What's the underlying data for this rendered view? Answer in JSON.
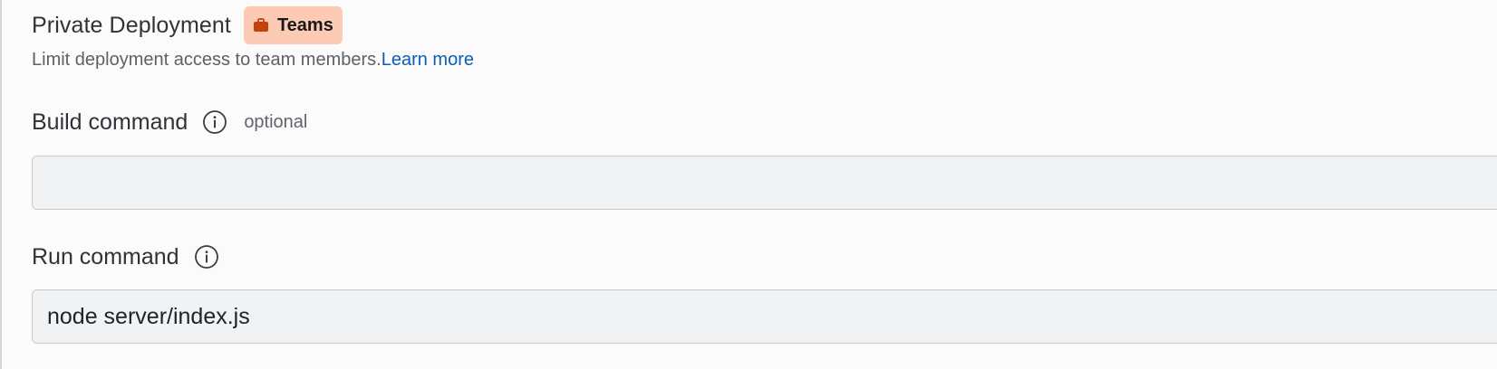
{
  "private_deployment": {
    "title": "Private Deployment",
    "badge": {
      "label": "Teams",
      "icon": "briefcase-icon",
      "color": "#fdcbb3",
      "icon_color": "#c4430a"
    },
    "description": "Limit deployment access to team members.",
    "link_text": "Learn more"
  },
  "build_command": {
    "label": "Build command",
    "icon": "info-icon",
    "hint": "optional",
    "value": "",
    "placeholder": ""
  },
  "run_command": {
    "label": "Run command",
    "icon": "info-icon",
    "value": "node server/index.js"
  },
  "colors": {
    "link": "#0a5fb4",
    "input_background": "#f1f2f4",
    "input_border": "#c7c9cd"
  }
}
